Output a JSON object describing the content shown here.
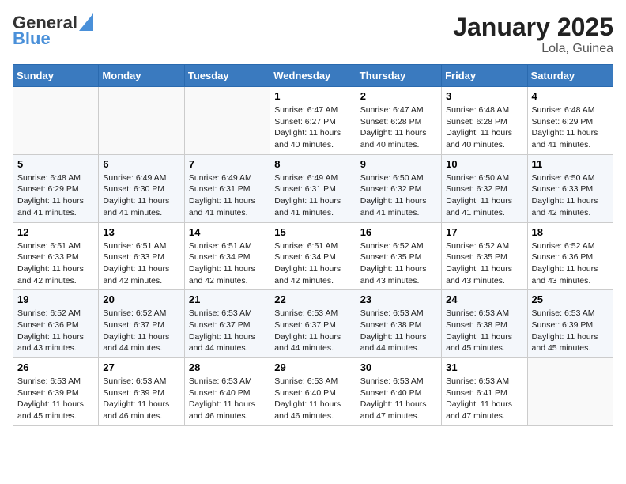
{
  "header": {
    "logo_line1": "General",
    "logo_line2": "Blue",
    "month": "January 2025",
    "location": "Lola, Guinea"
  },
  "weekdays": [
    "Sunday",
    "Monday",
    "Tuesday",
    "Wednesday",
    "Thursday",
    "Friday",
    "Saturday"
  ],
  "weeks": [
    [
      {
        "day": "",
        "info": ""
      },
      {
        "day": "",
        "info": ""
      },
      {
        "day": "",
        "info": ""
      },
      {
        "day": "1",
        "info": "Sunrise: 6:47 AM\nSunset: 6:27 PM\nDaylight: 11 hours and 40 minutes."
      },
      {
        "day": "2",
        "info": "Sunrise: 6:47 AM\nSunset: 6:28 PM\nDaylight: 11 hours and 40 minutes."
      },
      {
        "day": "3",
        "info": "Sunrise: 6:48 AM\nSunset: 6:28 PM\nDaylight: 11 hours and 40 minutes."
      },
      {
        "day": "4",
        "info": "Sunrise: 6:48 AM\nSunset: 6:29 PM\nDaylight: 11 hours and 41 minutes."
      }
    ],
    [
      {
        "day": "5",
        "info": "Sunrise: 6:48 AM\nSunset: 6:29 PM\nDaylight: 11 hours and 41 minutes."
      },
      {
        "day": "6",
        "info": "Sunrise: 6:49 AM\nSunset: 6:30 PM\nDaylight: 11 hours and 41 minutes."
      },
      {
        "day": "7",
        "info": "Sunrise: 6:49 AM\nSunset: 6:31 PM\nDaylight: 11 hours and 41 minutes."
      },
      {
        "day": "8",
        "info": "Sunrise: 6:49 AM\nSunset: 6:31 PM\nDaylight: 11 hours and 41 minutes."
      },
      {
        "day": "9",
        "info": "Sunrise: 6:50 AM\nSunset: 6:32 PM\nDaylight: 11 hours and 41 minutes."
      },
      {
        "day": "10",
        "info": "Sunrise: 6:50 AM\nSunset: 6:32 PM\nDaylight: 11 hours and 41 minutes."
      },
      {
        "day": "11",
        "info": "Sunrise: 6:50 AM\nSunset: 6:33 PM\nDaylight: 11 hours and 42 minutes."
      }
    ],
    [
      {
        "day": "12",
        "info": "Sunrise: 6:51 AM\nSunset: 6:33 PM\nDaylight: 11 hours and 42 minutes."
      },
      {
        "day": "13",
        "info": "Sunrise: 6:51 AM\nSunset: 6:33 PM\nDaylight: 11 hours and 42 minutes."
      },
      {
        "day": "14",
        "info": "Sunrise: 6:51 AM\nSunset: 6:34 PM\nDaylight: 11 hours and 42 minutes."
      },
      {
        "day": "15",
        "info": "Sunrise: 6:51 AM\nSunset: 6:34 PM\nDaylight: 11 hours and 42 minutes."
      },
      {
        "day": "16",
        "info": "Sunrise: 6:52 AM\nSunset: 6:35 PM\nDaylight: 11 hours and 43 minutes."
      },
      {
        "day": "17",
        "info": "Sunrise: 6:52 AM\nSunset: 6:35 PM\nDaylight: 11 hours and 43 minutes."
      },
      {
        "day": "18",
        "info": "Sunrise: 6:52 AM\nSunset: 6:36 PM\nDaylight: 11 hours and 43 minutes."
      }
    ],
    [
      {
        "day": "19",
        "info": "Sunrise: 6:52 AM\nSunset: 6:36 PM\nDaylight: 11 hours and 43 minutes."
      },
      {
        "day": "20",
        "info": "Sunrise: 6:52 AM\nSunset: 6:37 PM\nDaylight: 11 hours and 44 minutes."
      },
      {
        "day": "21",
        "info": "Sunrise: 6:53 AM\nSunset: 6:37 PM\nDaylight: 11 hours and 44 minutes."
      },
      {
        "day": "22",
        "info": "Sunrise: 6:53 AM\nSunset: 6:37 PM\nDaylight: 11 hours and 44 minutes."
      },
      {
        "day": "23",
        "info": "Sunrise: 6:53 AM\nSunset: 6:38 PM\nDaylight: 11 hours and 44 minutes."
      },
      {
        "day": "24",
        "info": "Sunrise: 6:53 AM\nSunset: 6:38 PM\nDaylight: 11 hours and 45 minutes."
      },
      {
        "day": "25",
        "info": "Sunrise: 6:53 AM\nSunset: 6:39 PM\nDaylight: 11 hours and 45 minutes."
      }
    ],
    [
      {
        "day": "26",
        "info": "Sunrise: 6:53 AM\nSunset: 6:39 PM\nDaylight: 11 hours and 45 minutes."
      },
      {
        "day": "27",
        "info": "Sunrise: 6:53 AM\nSunset: 6:39 PM\nDaylight: 11 hours and 46 minutes."
      },
      {
        "day": "28",
        "info": "Sunrise: 6:53 AM\nSunset: 6:40 PM\nDaylight: 11 hours and 46 minutes."
      },
      {
        "day": "29",
        "info": "Sunrise: 6:53 AM\nSunset: 6:40 PM\nDaylight: 11 hours and 46 minutes."
      },
      {
        "day": "30",
        "info": "Sunrise: 6:53 AM\nSunset: 6:40 PM\nDaylight: 11 hours and 47 minutes."
      },
      {
        "day": "31",
        "info": "Sunrise: 6:53 AM\nSunset: 6:41 PM\nDaylight: 11 hours and 47 minutes."
      },
      {
        "day": "",
        "info": ""
      }
    ]
  ]
}
